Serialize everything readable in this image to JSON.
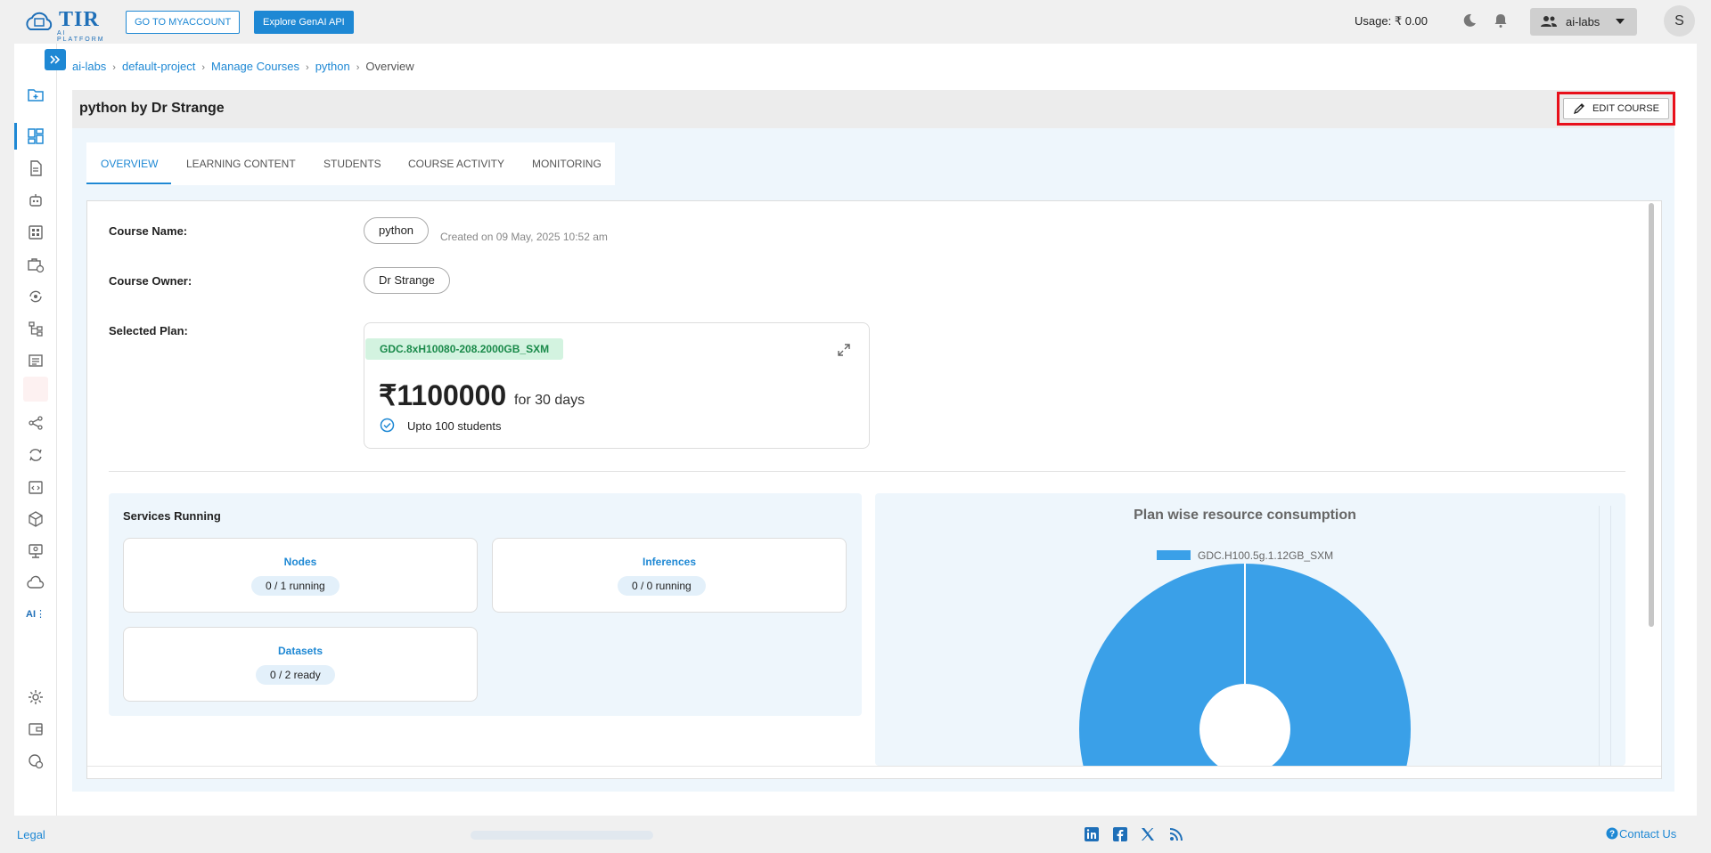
{
  "header": {
    "logo_text": "TIR",
    "logo_subtext": "AI PLATFORM",
    "myaccount_label": "GO TO MYACCOUNT",
    "genai_label": "Explore GenAI API",
    "usage_label": "Usage:",
    "usage_value": "₹ 0.00",
    "workspace": "ai-labs",
    "avatar_initial": "S"
  },
  "sidebar": {
    "ai_label": "AI"
  },
  "breadcrumb": {
    "items": [
      "ai-labs",
      "default-project",
      "Manage Courses",
      "python"
    ],
    "current": "Overview"
  },
  "course": {
    "title": "python by Dr Strange",
    "edit_label": "EDIT COURSE",
    "tabs": [
      "OVERVIEW",
      "LEARNING CONTENT",
      "STUDENTS",
      "COURSE ACTIVITY",
      "MONITORING"
    ],
    "name_label": "Course Name:",
    "name_value": "python",
    "created": "Created on 09 May, 2025 10:52 am",
    "owner_label": "Course Owner:",
    "owner_value": "Dr Strange",
    "plan_label": "Selected Plan:",
    "plan": {
      "name": "GDC.8xH10080-208.2000GB_SXM",
      "price": "₹1100000",
      "period": "for 30 days",
      "students": "Upto 100 students"
    }
  },
  "services": {
    "title": "Services Running",
    "items": [
      {
        "name": "Nodes",
        "status": "0 / 1 running"
      },
      {
        "name": "Inferences",
        "status": "0 / 0 running"
      },
      {
        "name": "Datasets",
        "status": "0 / 2 ready"
      }
    ]
  },
  "chart_data": {
    "type": "pie",
    "title": "Plan wise resource consumption",
    "series": [
      {
        "name": "GDC.H100.5g.1.12GB_SXM",
        "value": 100
      }
    ],
    "colors": [
      "#3aa0e8"
    ],
    "legend_position": "top"
  },
  "footer": {
    "legal": "Legal",
    "contact": "Contact Us"
  },
  "colors": {
    "primary": "#1e88d4",
    "highlight": "#e8101b",
    "plan_badge_bg": "#d3f3e0",
    "plan_badge_text": "#1a8a4a"
  }
}
